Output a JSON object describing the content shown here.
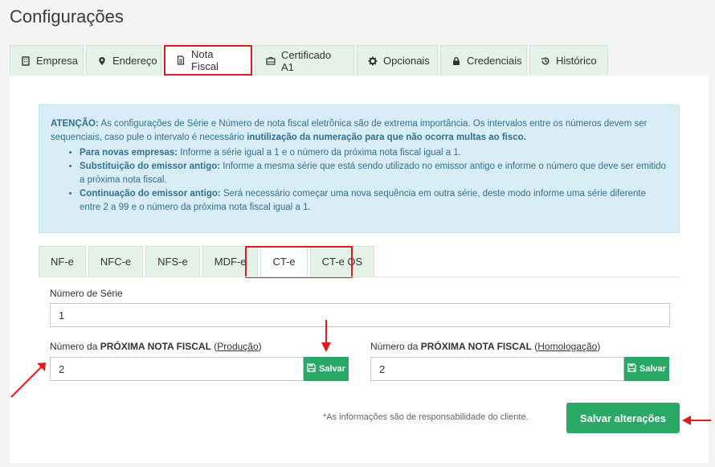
{
  "page": {
    "title": "Configurações"
  },
  "main_tabs": [
    {
      "label": "Empresa",
      "icon": "building-icon"
    },
    {
      "label": "Endereço",
      "icon": "map-marker-icon"
    },
    {
      "label": "Nota Fiscal",
      "icon": "document-icon"
    },
    {
      "label": "Certificado A1",
      "icon": "card-icon"
    },
    {
      "label": "Opcionais",
      "icon": "gear-icon"
    },
    {
      "label": "Credenciais",
      "icon": "lock-icon"
    },
    {
      "label": "Histórico",
      "icon": "history-icon"
    }
  ],
  "alert": {
    "lead_strong": "ATENÇÃO:",
    "lead_text": " As configurações de Série e Número de nota fiscal eletrônica são de extrema importância. Os intervalos entre os números devem ser sequenciais, caso pule o intervalo é necessário ",
    "lead_strong2": "inutilização da numeração para que não ocorra multas ao fisco.",
    "items": [
      {
        "strong": "Para novas empresas:",
        "text": " Informe a série igual a 1 e o número da próxima nota fiscal igual a 1."
      },
      {
        "strong": "Substituição do emissor antigo:",
        "text": " Informe a mesma série que está sendo utilizado no emissor antigo e informe o número que deve ser emitido a próxima nota fiscal."
      },
      {
        "strong": "Continuação do emissor antigo:",
        "text": " Será necessário começar uma nova sequência em outra série, deste modo informe uma série diferente entre 2 a 99 e o número da próxima nota fiscal igual a 1."
      }
    ]
  },
  "sub_tabs": [
    "NF-e",
    "NFC-e",
    "NFS-e",
    "MDF-e",
    "CT-e",
    "CT-e OS"
  ],
  "form": {
    "serie_label": "Número de Série",
    "serie_value": "1",
    "prox_prefix": "Número da ",
    "prox_strong": "PRÓXIMA NOTA FISCAL",
    "open_paren": " (",
    "close_paren": ")",
    "producao": "Produção",
    "homologacao": "Homologação",
    "producao_value": "2",
    "homologacao_value": "2",
    "salvar_label": "Salvar",
    "note": "*As informações são de responsabilidade do cliente.",
    "salvar_alteracoes": "Salvar alterações"
  },
  "colors": {
    "accent_green": "#2aa866",
    "highlight_red": "#e01b1b",
    "alert_bg": "#d9edf7",
    "tab_bg": "#e4f2e8"
  }
}
